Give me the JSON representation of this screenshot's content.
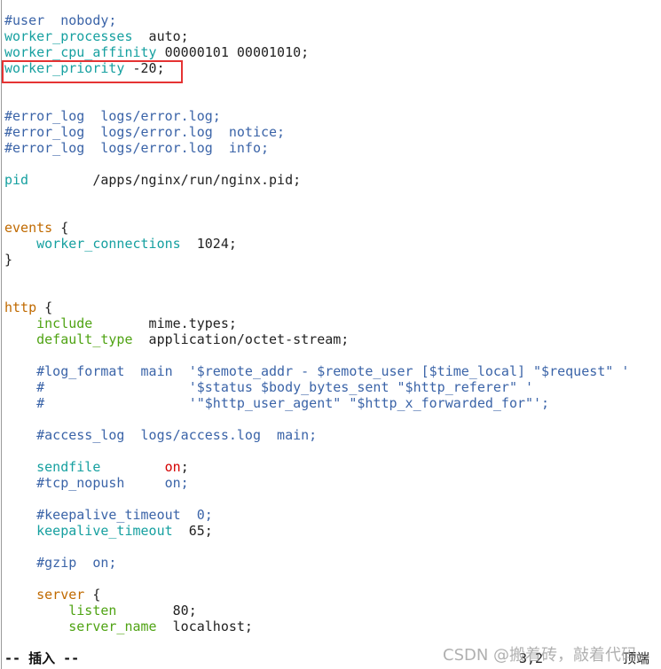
{
  "colors": {
    "comment": "#3b64a8",
    "directive": "#16a0a0",
    "block": "#c06a00",
    "module": "#4fa313",
    "value_on": "#d40000",
    "highlight_box": "#e53333"
  },
  "lines": [
    [
      {
        "t": "#user  nobody;",
        "c": "comment"
      }
    ],
    [
      {
        "t": "worker_processes",
        "c": "directive"
      },
      {
        "t": "  auto;",
        "c": "plain"
      }
    ],
    [
      {
        "t": "worker_cpu_affinity",
        "c": "directive"
      },
      {
        "t": " 00000101 00001010;",
        "c": "plain"
      }
    ],
    [
      {
        "t": "worker_priority",
        "c": "directive"
      },
      {
        "t": " -20;",
        "c": "plain"
      }
    ],
    [],
    [],
    [
      {
        "t": "#error_log  logs/error.log;",
        "c": "comment"
      }
    ],
    [
      {
        "t": "#error_log  logs/error.log  notice;",
        "c": "comment"
      }
    ],
    [
      {
        "t": "#error_log  logs/error.log  info;",
        "c": "comment"
      }
    ],
    [],
    [
      {
        "t": "pid",
        "c": "directive"
      },
      {
        "t": "        /apps/nginx/run/nginx.pid;",
        "c": "plain"
      }
    ],
    [],
    [],
    [
      {
        "t": "events",
        "c": "block"
      },
      {
        "t": " {",
        "c": "plain"
      }
    ],
    [
      {
        "t": "    ",
        "c": "plain"
      },
      {
        "t": "worker_connections",
        "c": "directive"
      },
      {
        "t": "  1024;",
        "c": "plain"
      }
    ],
    [
      {
        "t": "}",
        "c": "plain"
      }
    ],
    [],
    [],
    [
      {
        "t": "http",
        "c": "block"
      },
      {
        "t": " {",
        "c": "plain"
      }
    ],
    [
      {
        "t": "    ",
        "c": "plain"
      },
      {
        "t": "include",
        "c": "module"
      },
      {
        "t": "       mime.types;",
        "c": "plain"
      }
    ],
    [
      {
        "t": "    ",
        "c": "plain"
      },
      {
        "t": "default_type",
        "c": "module"
      },
      {
        "t": "  application/octet-stream;",
        "c": "plain"
      }
    ],
    [],
    [
      {
        "t": "    #log_format  main  '$remote_addr - $remote_user [$time_local] \"$request\" '",
        "c": "comment"
      }
    ],
    [
      {
        "t": "    #                  '$status $body_bytes_sent \"$http_referer\" '",
        "c": "comment"
      }
    ],
    [
      {
        "t": "    #                  '\"$http_user_agent\" \"$http_x_forwarded_for\"';",
        "c": "comment"
      }
    ],
    [],
    [
      {
        "t": "    #access_log  logs/access.log  main;",
        "c": "comment"
      }
    ],
    [],
    [
      {
        "t": "    ",
        "c": "plain"
      },
      {
        "t": "sendfile",
        "c": "directive"
      },
      {
        "t": "        ",
        "c": "plain"
      },
      {
        "t": "on",
        "c": "red"
      },
      {
        "t": ";",
        "c": "plain"
      }
    ],
    [
      {
        "t": "    #tcp_nopush     on;",
        "c": "comment"
      }
    ],
    [],
    [
      {
        "t": "    #keepalive_timeout  0;",
        "c": "comment"
      }
    ],
    [
      {
        "t": "    ",
        "c": "plain"
      },
      {
        "t": "keepalive_timeout",
        "c": "directive"
      },
      {
        "t": "  65;",
        "c": "plain"
      }
    ],
    [],
    [
      {
        "t": "    #gzip  on;",
        "c": "comment"
      }
    ],
    [],
    [
      {
        "t": "    ",
        "c": "plain"
      },
      {
        "t": "server",
        "c": "block"
      },
      {
        "t": " {",
        "c": "plain"
      }
    ],
    [
      {
        "t": "        ",
        "c": "plain"
      },
      {
        "t": "listen",
        "c": "module"
      },
      {
        "t": "       80;",
        "c": "plain"
      }
    ],
    [
      {
        "t": "        ",
        "c": "plain"
      },
      {
        "t": "server_name",
        "c": "module"
      },
      {
        "t": "  localhost;",
        "c": "plain"
      }
    ]
  ],
  "status": {
    "mode": "-- 插入 --",
    "position": "3,2",
    "scroll": "顶端"
  },
  "watermark": "CSDN @搬着砖，敲着代码"
}
